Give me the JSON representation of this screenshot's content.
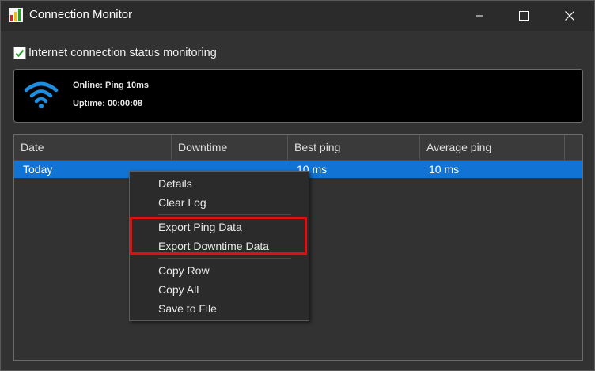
{
  "window": {
    "title": "Connection Monitor",
    "icon": "app-bars-icon",
    "controls": [
      "minimize-icon",
      "maximize-icon",
      "close-icon"
    ]
  },
  "monitoring": {
    "checked": true,
    "label": "Internet connection status monitoring"
  },
  "status": {
    "icon": "wifi-icon",
    "online": "Online: Ping 10ms",
    "uptime": "Uptime: 00:00:08",
    "accent": "#1e8fe0"
  },
  "table": {
    "columns": [
      "Date",
      "Downtime",
      "Best ping",
      "Average ping"
    ],
    "rows": [
      {
        "date": "Today",
        "downtime": "",
        "best": "10 ms",
        "avg": "10 ms",
        "selected": true
      }
    ],
    "selection_color": "#1173d4"
  },
  "context_menu": {
    "groups": [
      [
        "Details",
        "Clear Log"
      ],
      [
        "Export Ping Data",
        "Export Downtime Data"
      ],
      [
        "Copy Row",
        "Copy All",
        "Save to File"
      ]
    ],
    "highlight_color": "#e01010"
  }
}
